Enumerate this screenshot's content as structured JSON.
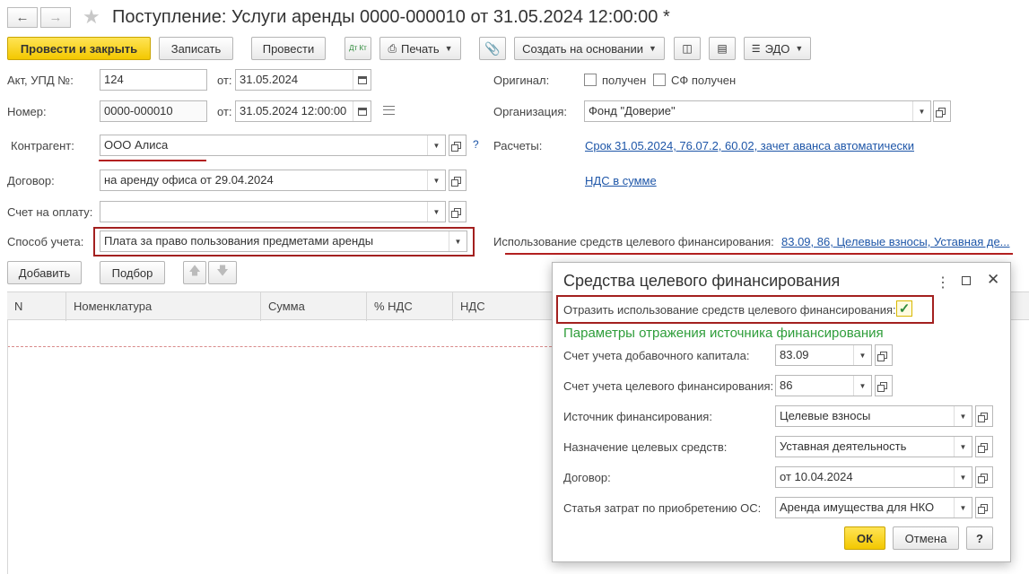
{
  "header": {
    "title": "Поступление: Услуги аренды 0000-000010 от 31.05.2024 12:00:00 *"
  },
  "toolbar": {
    "post_close": "Провести и закрыть",
    "save": "Записать",
    "post": "Провести",
    "dt_kt_label": "Дт Кт",
    "print": "Печать",
    "create_based": "Создать на основании",
    "edo": "ЭДО"
  },
  "form": {
    "act_label": "Акт, УПД №:",
    "act_value": "124",
    "from_label": "от:",
    "act_date": "31.05.2024",
    "number_label": "Номер:",
    "number_value": "0000-000010",
    "from2_label": "от:",
    "number_date": "31.05.2024 12:00:00",
    "counterparty_label": "Контрагент:",
    "counterparty_value": "ООО Алиса",
    "help_mark": "?",
    "contract_label": "Договор:",
    "contract_value": "на аренду офиса от 29.04.2024",
    "invoice_label": "Счет на оплату:",
    "invoice_value": "",
    "method_label": "Способ учета:",
    "method_value": "Плата за право пользования предметами аренды",
    "original_label": "Оригинал:",
    "received_label": "получен",
    "sf_received_label": "СФ получен",
    "org_label": "Организация:",
    "org_value": "Фонд \"Доверие\"",
    "settlements_label": "Расчеты:",
    "settlements_link": "Срок 31.05.2024, 76.07.2, 60.02, зачет аванса автоматически",
    "vat_link": "НДС в сумме",
    "target_usage_label": "Использование средств целевого финансирования:",
    "target_usage_link": "83.09, 86, Целевые взносы, Уставная де..."
  },
  "table_toolbar": {
    "add": "Добавить",
    "select": "Подбор"
  },
  "table": {
    "columns": [
      "N",
      "Номенклатура",
      "Сумма",
      "% НДС",
      "НДС"
    ]
  },
  "dialog": {
    "title": "Средства целевого финансирования",
    "reflect_label": "Отразить использование средств целевого финансирования:",
    "reflect_checked": true,
    "section_title": "Параметры отражения источника финансирования",
    "rows": [
      {
        "label": "Счет учета добавочного капитала:",
        "value": "83.09"
      },
      {
        "label": "Счет учета целевого финансирования:",
        "value": "86"
      },
      {
        "label": "Источник финансирования:",
        "value": "Целевые взносы"
      },
      {
        "label": "Назначение целевых средств:",
        "value": "Уставная деятельность"
      },
      {
        "label": "Договор:",
        "value": "от 10.04.2024"
      },
      {
        "label": "Статья затрат по приобретению ОС:",
        "value": "Аренда имущества для НКО"
      }
    ],
    "ok": "ОК",
    "cancel": "Отмена",
    "help": "?"
  },
  "colors": {
    "primary_button": "#f3c800",
    "link": "#1e56a8",
    "section_green": "#2e9d3a",
    "highlight_red": "#a3201f"
  }
}
